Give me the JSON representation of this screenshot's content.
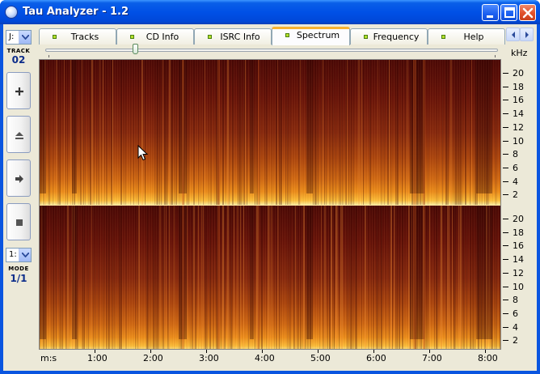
{
  "window": {
    "title": "Tau Analyzer - 1.2"
  },
  "left_panel": {
    "drive_select": "J:",
    "track_label": "TRACK",
    "track_value": "02",
    "mode_select": "1:",
    "mode_label": "MODE",
    "mode_value": "1/1"
  },
  "tabs": [
    {
      "label": "Tracks"
    },
    {
      "label": "CD Info"
    },
    {
      "label": "ISRC Info"
    },
    {
      "label": "Spectrum",
      "active": true
    },
    {
      "label": "Frequency"
    },
    {
      "label": "Help"
    }
  ],
  "spectrum": {
    "y_unit": "kHz",
    "y_ticks": [
      "20",
      "18",
      "16",
      "14",
      "12",
      "10",
      "8",
      "6",
      "4",
      "2"
    ],
    "x_unit": "m:s",
    "x_ticks": [
      "1:00",
      "2:00",
      "3:00",
      "4:00",
      "5:00",
      "6:00",
      "7:00",
      "8:00"
    ]
  },
  "colors": {
    "titlebar": "#0050e6",
    "tab_active_accent": "#f8b330",
    "spectrum_low": "#4e0906",
    "spectrum_high": "#fff0a0"
  }
}
